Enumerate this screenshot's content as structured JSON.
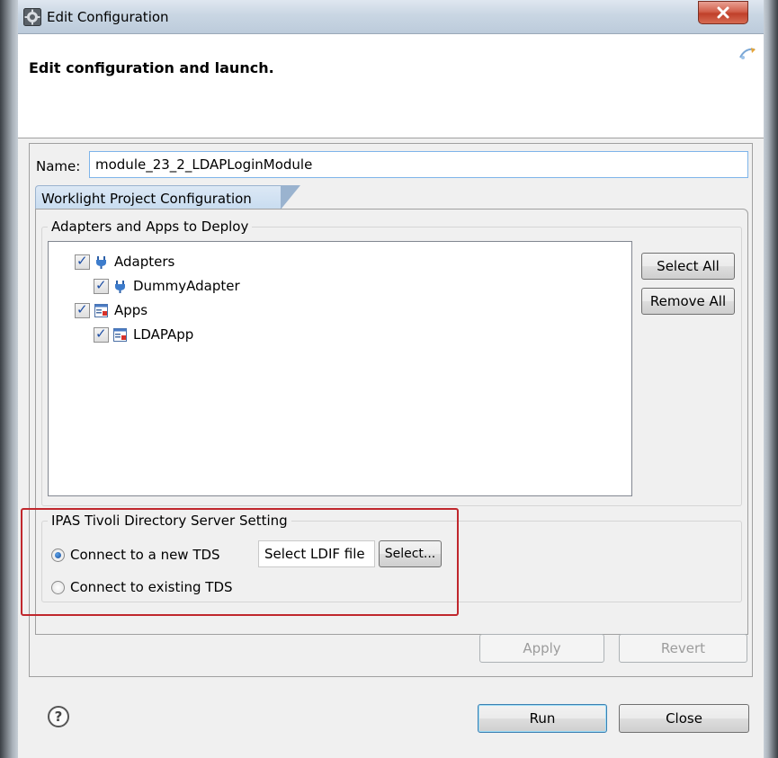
{
  "window": {
    "title": "Edit Configuration",
    "header_title": "Edit configuration and launch."
  },
  "config": {
    "name_label": "Name:",
    "name_value": "module_23_2_LDAPLoginModule"
  },
  "tab": {
    "label": "Worklight Project Configuration"
  },
  "deploy_group": {
    "title": "Adapters and Apps to Deploy",
    "tree": [
      {
        "label": "Adapters",
        "checked": true,
        "icon": "adapter-icon",
        "level": 0
      },
      {
        "label": "DummyAdapter",
        "checked": true,
        "icon": "adapter-icon",
        "level": 1
      },
      {
        "label": "Apps",
        "checked": true,
        "icon": "app-icon",
        "level": 0
      },
      {
        "label": "LDAPApp",
        "checked": true,
        "icon": "app-icon",
        "level": 1
      }
    ],
    "select_all_label": "Select All",
    "remove_all_label": "Remove All"
  },
  "tds_group": {
    "title": "IPAS Tivoli Directory Server Setting",
    "option_new": "Connect to a new TDS",
    "option_existing": "Connect to existing TDS",
    "selected_option": "new",
    "ldif_value": "Select LDIF file",
    "select_button_label": "Select..."
  },
  "actions": {
    "apply_label": "Apply",
    "revert_label": "Revert",
    "run_label": "Run",
    "close_label": "Close"
  },
  "colors": {
    "highlight_border": "#c0272d",
    "close_button": "#c0402a",
    "checkmark": "#1f4fa5"
  }
}
